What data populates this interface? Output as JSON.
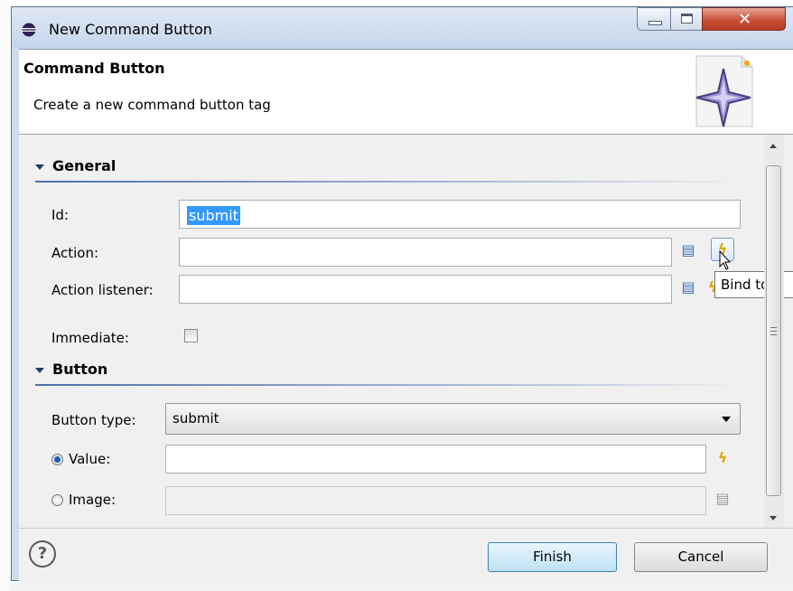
{
  "window": {
    "title": "New Command Button"
  },
  "header": {
    "title": "Command Button",
    "description": "Create a new command button tag"
  },
  "sections": {
    "general": "General",
    "button": "Button"
  },
  "fields": {
    "id_label": "Id:",
    "id_value": "submit",
    "action_label": "Action:",
    "action_value": "",
    "action_listener_label": "Action listener:",
    "action_listener_value": "",
    "immediate_label": "Immediate:",
    "immediate_checked": false,
    "button_type_label": "Button type:",
    "button_type_value": "submit",
    "value_label": "Value:",
    "value_value": "",
    "value_selected": true,
    "image_label": "Image:",
    "image_value": "",
    "image_selected": false
  },
  "tooltip": {
    "text": "Bind to a"
  },
  "footer": {
    "help_symbol": "?",
    "finish_label": "Finish",
    "cancel_label": "Cancel"
  },
  "icons": {
    "app": "eclipse-icon",
    "wizard_banner": "wizard-sparkle-icon",
    "browse": "browse-document-icon",
    "bind": "lightning-bolt-icon",
    "help": "help-icon"
  },
  "colors": {
    "selection": "#3399ff",
    "bolt": "#e0a800",
    "close_button": "#c9503a"
  }
}
